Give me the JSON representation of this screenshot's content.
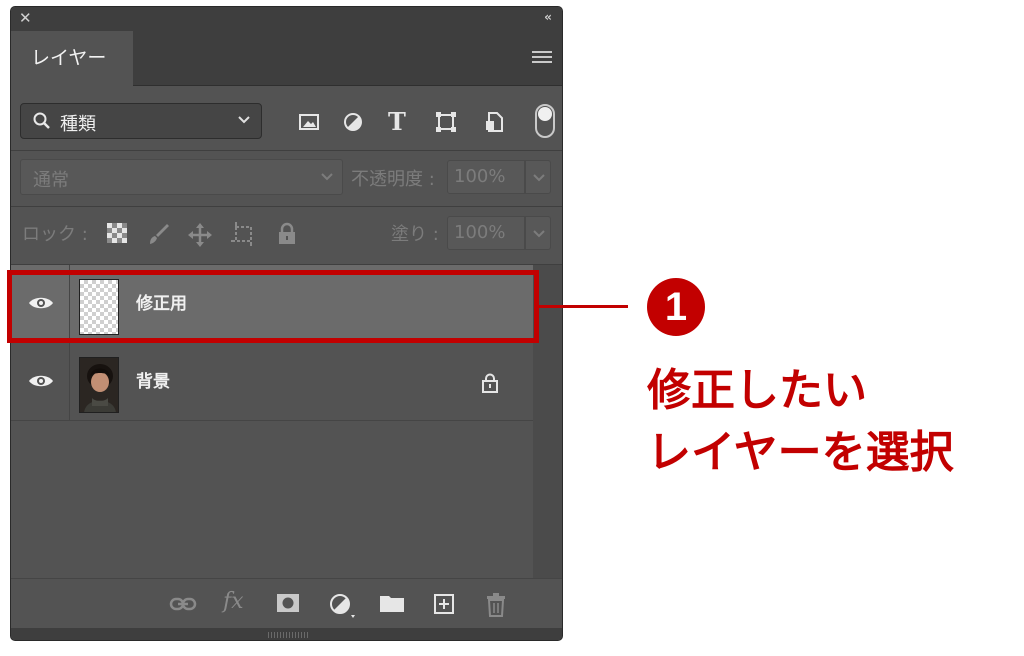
{
  "panel": {
    "tab_label": "レイヤー",
    "filter": {
      "label": "種類",
      "icons": [
        "image-filter-icon",
        "adjustment-filter-icon",
        "type-filter-icon",
        "shape-filter-icon",
        "smart-object-filter-icon"
      ],
      "type_filter_glyph": "T"
    },
    "blend_mode": "通常",
    "opacity_label": "不透明度 :",
    "opacity_value": "100%",
    "lock_label": "ロック :",
    "lock_icons": [
      "lock-transparent-pixels-icon",
      "lock-image-pixels-icon",
      "lock-position-icon",
      "lock-artboard-icon",
      "lock-all-icon"
    ],
    "fill_label": "塗り :",
    "fill_value": "100%",
    "layers": [
      {
        "name": "修正用",
        "visible": true,
        "selected": true,
        "locked": false,
        "thumbnail": "transparent"
      },
      {
        "name": "背景",
        "visible": true,
        "selected": false,
        "locked": true,
        "thumbnail": "photo"
      }
    ],
    "footer_icons": [
      "link-layers-icon",
      "fx-icon",
      "add-mask-icon",
      "new-adjustment-layer-icon",
      "new-group-icon",
      "new-layer-icon",
      "delete-layer-icon"
    ],
    "fx_label": "fx"
  },
  "annotation": {
    "number": "1",
    "line1": "修正したい",
    "line2": "レイヤーを選択",
    "color": "#c20000"
  },
  "colors": {
    "panel_bg": "#535353",
    "header_bg": "#3e3e3e",
    "selected_row": "#6b6b6b"
  }
}
